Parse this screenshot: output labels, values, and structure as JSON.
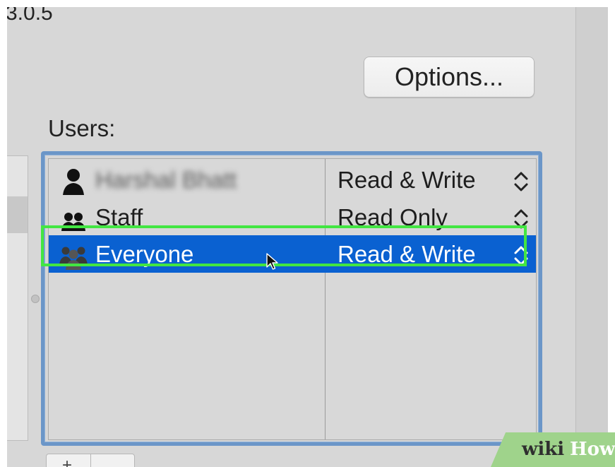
{
  "header": {
    "version_fragment": "3.0.5"
  },
  "options_button": {
    "label": "Options..."
  },
  "users": {
    "label": "Users:",
    "rows": [
      {
        "name": "Harshal Bhatt",
        "permission": "Read & Write",
        "icon": "single-user-icon",
        "selected": false
      },
      {
        "name": "Staff",
        "permission": "Read Only",
        "icon": "group-icon",
        "selected": false
      },
      {
        "name": "Everyone",
        "permission": "Read & Write",
        "icon": "everyone-icon",
        "selected": true
      }
    ]
  },
  "bottom_controls": {
    "add_label": "+"
  },
  "watermark": {
    "wiki": "wiki",
    "how": "How"
  },
  "colors": {
    "selection": "#0a61d1",
    "highlight": "#42e642",
    "frame": "#6b96c8",
    "watermark": "#9fd38b"
  }
}
